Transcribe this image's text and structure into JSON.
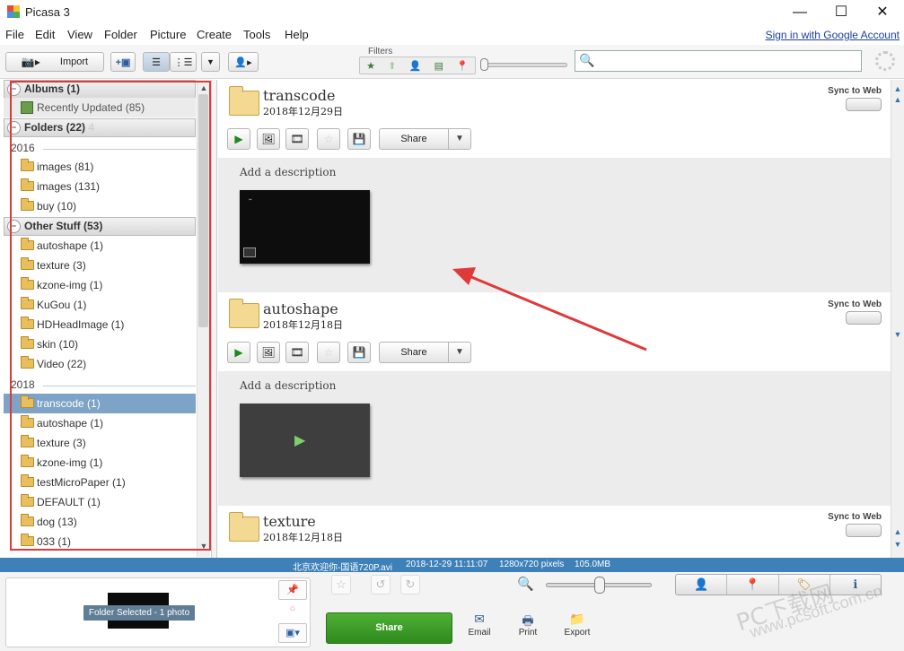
{
  "window": {
    "title": "Picasa 3",
    "minimize": "—",
    "maximize": "☐",
    "close": "✕"
  },
  "menu": [
    "File",
    "Edit",
    "View",
    "Folder",
    "Picture",
    "Create",
    "Tools",
    "Help"
  ],
  "signin": "Sign in with Google Account",
  "toolbar": {
    "import_label": "Import",
    "filters_label": "Filters",
    "search_placeholder": ""
  },
  "left_panel": {
    "albums_header": "Albums (1)",
    "recently_updated": "Recently Updated (85)",
    "folders_header": "Folders (22)",
    "folders_header_ghost": "4",
    "year_2016": "2016",
    "folders_2016": [
      "images (81)",
      "images (131)",
      "buy (10)"
    ],
    "other_header": "Other Stuff (53)",
    "other_items": [
      "autoshape (1)",
      "texture (3)",
      "kzone-img (1)",
      "KuGou (1)",
      "HDHeadImage (1)",
      "skin (10)",
      "Video (22)"
    ],
    "year_2018": "2018",
    "folders_2018": [
      "transcode (1)",
      "autoshape (1)",
      "texture (3)",
      "kzone-img (1)",
      "testMicroPaper (1)",
      "DEFAULT (1)",
      "dog (13)",
      "033 (1)"
    ]
  },
  "sections": [
    {
      "title": "transcode",
      "date": "2018年12月29日",
      "sync": "Sync to Web",
      "share": "Share",
      "desc": "Add a description"
    },
    {
      "title": "autoshape",
      "date": "2018年12月18日",
      "sync": "Sync to Web",
      "share": "Share",
      "desc": "Add a description"
    },
    {
      "title": "texture",
      "date": "2018年12月18日",
      "sync": "Sync to Web"
    }
  ],
  "status": {
    "file": "北京欢迎你-国语720P.avi",
    "datetime": "2018-12-29 11:11:07",
    "dimensions": "1280x720 pixels",
    "size": "105.0MB"
  },
  "tray": {
    "selected_label": "Folder Selected - 1 photo",
    "share": "Share",
    "email": "Email",
    "print": "Print",
    "export": "Export"
  },
  "watermark": {
    "line1": "PC下载网",
    "line2": "www.pcsoft.com.cn"
  },
  "colors": {
    "statusbar": "#3e80b8",
    "selection": "#7da3c6",
    "annotation": "#e0393a",
    "share_green": "#3a9c28"
  }
}
